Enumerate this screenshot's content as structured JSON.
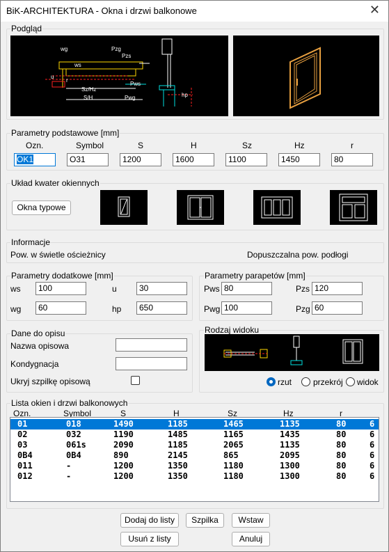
{
  "window": {
    "title": "BiK-ARCHITEKTURA - Okna i drzwi balkonowe",
    "close": "✕"
  },
  "preview": {
    "label": "Podgląd",
    "dim_labels": [
      "wg",
      "Pzg",
      "Pzs",
      "ws",
      "u",
      "r",
      "Sz/Hz",
      "S/H",
      "Pws",
      "Pwg",
      "hp"
    ]
  },
  "basic": {
    "label": "Parametry podstawowe [mm]",
    "headers": [
      "Ozn.",
      "Symbol",
      "S",
      "H",
      "Sz",
      "Hz",
      "r"
    ],
    "values": [
      "OK1",
      "O31",
      "1200",
      "1600",
      "1100",
      "1450",
      "80"
    ]
  },
  "layout": {
    "label": "Układ kwater okiennych",
    "button": "Okna typowe"
  },
  "info": {
    "label": "Informacje",
    "left": "Pow. w świetle ościeżnicy",
    "right": "Dopuszczalna pow. podłogi"
  },
  "extra": {
    "label": "Parametry dodatkowe [mm]",
    "fields": [
      {
        "name": "ws",
        "value": "100"
      },
      {
        "name": "u",
        "value": "30"
      },
      {
        "name": "wg",
        "value": "60"
      },
      {
        "name": "hp",
        "value": "650"
      }
    ]
  },
  "sill": {
    "label": "Parametry parapetów [mm]",
    "fields": [
      {
        "name": "Pws",
        "value": "80"
      },
      {
        "name": "Pzs",
        "value": "120"
      },
      {
        "name": "Pwg",
        "value": "100"
      },
      {
        "name": "Pzg",
        "value": "60"
      }
    ]
  },
  "desc": {
    "label": "Dane do opisu",
    "name_label": "Nazwa opisowa",
    "name_value": "",
    "storey_label": "Kondygnacja",
    "storey_value": "",
    "hide_label": "Ukryj szpilkę opisową",
    "hide_checked": false
  },
  "view": {
    "label": "Rodzaj widoku",
    "options": [
      "rzut",
      "przekrój",
      "widok"
    ],
    "selected": "rzut"
  },
  "list": {
    "label": "Lista okien i drzwi balkonowych",
    "headers": [
      "Ozn.",
      "Symbol",
      "S",
      "H",
      "Sz",
      "Hz",
      "r"
    ],
    "rows": [
      [
        "01",
        "018",
        "1490",
        "1185",
        "1465",
        "1135",
        "80",
        "6"
      ],
      [
        "02",
        "032",
        "1190",
        "1485",
        "1165",
        "1435",
        "80",
        "6"
      ],
      [
        "03",
        "061s",
        "2090",
        "1185",
        "2065",
        "1135",
        "80",
        "6"
      ],
      [
        "0B4",
        "0B4",
        "890",
        "2145",
        "865",
        "2095",
        "80",
        "6"
      ],
      [
        "011",
        "-",
        "1200",
        "1350",
        "1180",
        "1300",
        "80",
        "6"
      ],
      [
        "012",
        "-",
        "1200",
        "1350",
        "1180",
        "1300",
        "80",
        "6"
      ]
    ],
    "selected_index": 0
  },
  "buttons": {
    "add": "Dodaj do listy",
    "pin": "Szpilka",
    "insert": "Wstaw",
    "remove": "Usuń z listy",
    "cancel": "Anuluj"
  },
  "colors": {
    "accent": "#0078d7",
    "cad_yellow": "#ffd700",
    "cad_red": "#ff2020",
    "cad_cyan": "#00e0e0",
    "cad_orange": "#e8a040"
  }
}
